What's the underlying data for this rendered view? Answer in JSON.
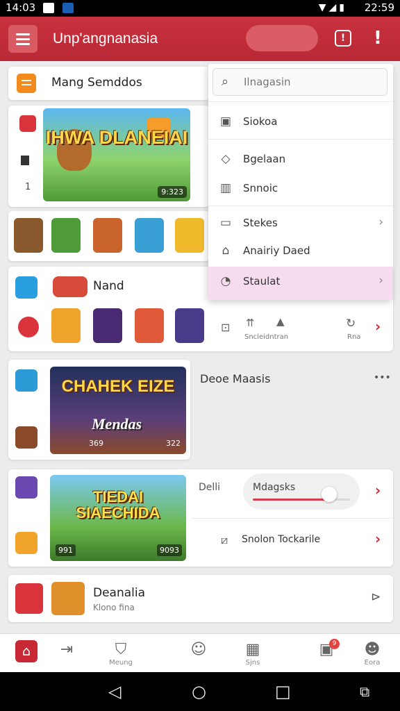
{
  "status_bar": {
    "time_left": "14:03",
    "time_right": "22:59",
    "brand_colors": [
      "#ffffff",
      "#1a5fb4"
    ]
  },
  "app_bar": {
    "title": "Unp'angnanasia",
    "accent": "#c72a35",
    "icons": [
      "menu-icon",
      "info-icon",
      "alert-icon"
    ]
  },
  "cards": {
    "header": {
      "label": "Mang Semddos",
      "icon": "menu-list-icon"
    },
    "featured": {
      "banner_title": "IHWA DLANEIAI",
      "badge": "9:323",
      "side_number": "1",
      "tiles": 5
    },
    "nand": {
      "title": "Nand",
      "tiles": 4
    },
    "deoe": {
      "title": "Deoe Maasis",
      "banner_title": "CHAHEK EIZE",
      "banner_subtitle": "Mendas",
      "badge_left": "369",
      "badge_right": "322",
      "more": "•••"
    },
    "slider_card": {
      "banner_title": "TIEDAI SIAECHIDA",
      "badge_left": "991",
      "badge_right": "9093",
      "label": "Delli",
      "slider_label": "Mdagsks",
      "slider_value": 0.75,
      "row_label": "Snolon Tockarile"
    },
    "bottom_card": {
      "title": "Deanalia",
      "subtitle": "Klono fina"
    }
  },
  "dropdown": {
    "search_placeholder": "Ilnagasin",
    "items": [
      {
        "label": "Siokoa",
        "icon": "clipboard-icon"
      },
      {
        "label": "Bgelaan",
        "icon": "diamond-icon"
      },
      {
        "label": "Snnoic",
        "icon": "pause-box-icon"
      },
      {
        "label": "Stekes",
        "icon": "tab-icon"
      },
      {
        "label": "Anairiy Daed",
        "icon": "lock-icon"
      },
      {
        "label": "Staulat",
        "icon": "clock-icon"
      }
    ]
  },
  "action_row": {
    "label_1": "Sncleidntran",
    "label_2": "Rna"
  },
  "bottom_nav": {
    "label_1": "Meung",
    "label_2": "Sjns",
    "label_3": "Eora",
    "badge": "9"
  }
}
